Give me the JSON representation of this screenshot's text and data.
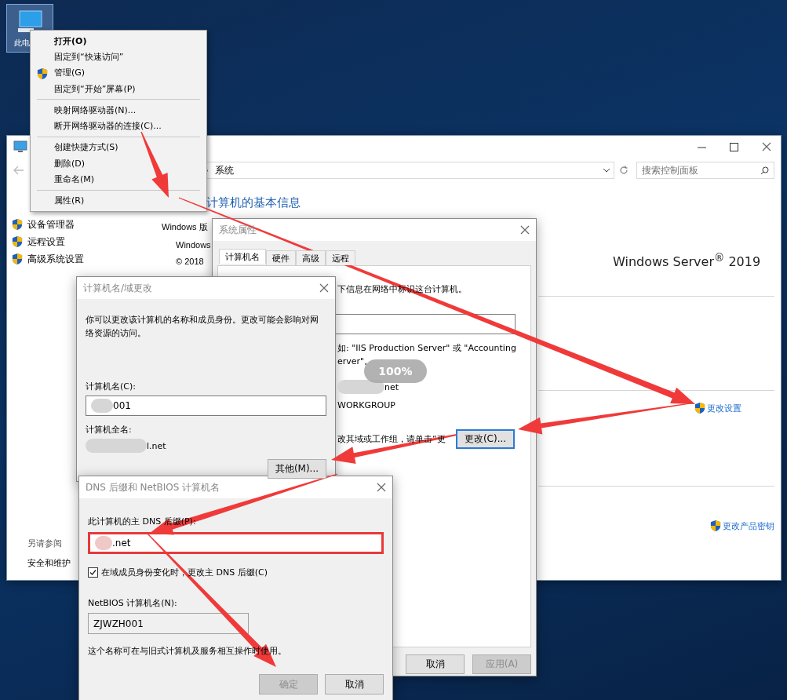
{
  "desktop": {
    "icon_label": "此电"
  },
  "context_menu": {
    "groups": [
      [
        {
          "label": "打开(O)",
          "kind": "default"
        },
        {
          "label": "固定到“快速访问”",
          "kind": "plain"
        },
        {
          "label": "管理(G)",
          "kind": "shield"
        },
        {
          "label": "固定到“开始”屏幕(P)",
          "kind": "plain"
        }
      ],
      [
        {
          "label": "映射网络驱动器(N)...",
          "kind": "plain"
        },
        {
          "label": "断开网络驱动器的连接(C)...",
          "kind": "plain"
        }
      ],
      [
        {
          "label": "创建快捷方式(S)",
          "kind": "plain"
        },
        {
          "label": "删除(D)",
          "kind": "plain"
        },
        {
          "label": "重命名(M)",
          "kind": "plain"
        }
      ],
      [
        {
          "label": "属性(R)",
          "kind": "plain"
        }
      ]
    ]
  },
  "control_panel": {
    "address": "系统",
    "search": {
      "placeholder": "搜索控制面板"
    },
    "sidebar": {
      "items": [
        "设备管理器",
        "远程设置",
        "高级系统设置"
      ],
      "see_also_title": "另请参阅",
      "see_also": [
        "安全和维护"
      ]
    },
    "heading": "计算机的基本信息",
    "edition_label": "Windows 版",
    "edition_lines": [
      "Windows",
      "© 2018"
    ],
    "logo_text": "Windows Server$^{®}$ 2019",
    "change_settings_link": "更改设置",
    "product_key_link": "更改产品密钥"
  },
  "system_properties": {
    "title": "系统属性",
    "tabs": [
      {
        "label": "计算机名",
        "selected": true
      },
      {
        "label": "硬件",
        "selected": false
      },
      {
        "label": "高级",
        "selected": false
      },
      {
        "label": "远程",
        "selected": false
      }
    ],
    "intro": "下信息在网络中标识这台计算机。",
    "example": [
      "如: \"IIS Production Server\" 或 \"Accounting",
      "erver\"。"
    ],
    "full_name": "net",
    "workgroup": "WORKGROUP",
    "change_hint": "改其域或工作组，请单击“更",
    "change_button": {
      "label": "更改(C)...",
      "focused": true
    },
    "buttons": [
      {
        "label": "取消",
        "disabled": false
      },
      {
        "label": "应用(A)",
        "disabled": true
      }
    ],
    "zoom_badge": "100%"
  },
  "computer_name_dialog": {
    "title": "计算机名/域更改",
    "description": "你可以更改该计算机的名称和成员身份。更改可能会影响对网络资源的访问。",
    "name_label": "计算机名(C):",
    "name_value": "001",
    "full_name_label": "计算机全名:",
    "full_name": "l.net",
    "more_button": "其他(M)..."
  },
  "dns_dialog": {
    "title": "DNS 后缀和 NetBIOS 计算机名",
    "suffix_label": "此计算机的主 DNS 后缀(P):",
    "suffix_value": ".net",
    "highlighted": true,
    "checkbox": {
      "label": "在域成员身份变化时，更改主 DNS 后缀(C)",
      "checked": true
    },
    "netbios_label": "NetBIOS 计算机名(N):",
    "netbios_value": "ZJWZH001",
    "note": "这个名称可在与旧式计算机及服务相互操作时使用。",
    "buttons": [
      {
        "label": "确定",
        "disabled": true
      },
      {
        "label": "取消",
        "disabled": false
      }
    ]
  }
}
